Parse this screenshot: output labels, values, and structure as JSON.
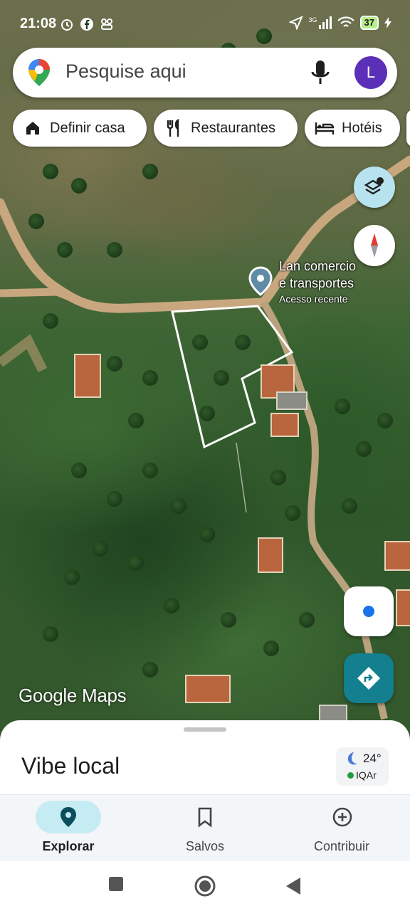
{
  "status_bar": {
    "time": "21:08",
    "network": "3G",
    "battery": "37"
  },
  "search": {
    "placeholder": "Pesquise aqui",
    "avatar_initial": "L"
  },
  "chips": [
    {
      "label": "Definir casa",
      "icon": "home-icon"
    },
    {
      "label": "Restaurantes",
      "icon": "restaurant-icon"
    },
    {
      "label": "Hotéis",
      "icon": "hotel-icon"
    }
  ],
  "map": {
    "place": {
      "name_line1": "Lan comercio",
      "name_line2": "e transportes",
      "subtitle": "Acesso recente"
    },
    "watermark": "Google Maps"
  },
  "bottom_sheet": {
    "title": "Vibe local",
    "weather": {
      "temperature": "24°",
      "air_quality": "IQAr"
    }
  },
  "nav": [
    {
      "label": "Explorar",
      "active": true
    },
    {
      "label": "Salvos",
      "active": false
    },
    {
      "label": "Contribuir",
      "active": false
    }
  ],
  "colors": {
    "accent_teal": "#137f8f",
    "active_pill": "#c5ebf3",
    "avatar": "#5b2fb7",
    "location_blue": "#1a73e8"
  }
}
